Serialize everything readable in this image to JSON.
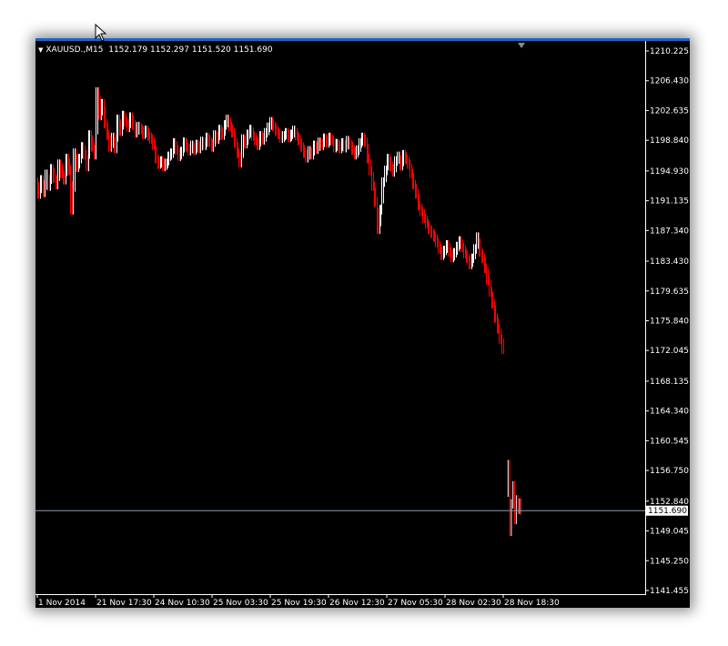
{
  "header": {
    "symbol": "XAUUSD.,M15",
    "ohlc": "1152.179 1152.297 1151.520 1151.690"
  },
  "chart_data": {
    "type": "candlestick",
    "colors": {
      "background": "#000000",
      "up": "#ffffff",
      "down": "#ff0000",
      "bid_line": "#8c9aa8",
      "axis_text": "#ffffff",
      "top_line": "#1f63c8"
    },
    "y_ticks": [
      "1210.225",
      "1206.430",
      "1202.635",
      "1198.840",
      "1194.930",
      "1191.135",
      "1187.340",
      "1183.430",
      "1179.635",
      "1175.840",
      "1172.045",
      "1168.135",
      "1164.340",
      "1160.545",
      "1156.750",
      "1152.840",
      "1149.045",
      "1145.250",
      "1141.455"
    ],
    "x_ticks": [
      "1 Nov 2014",
      "21 Nov 17:30",
      "24 Nov 10:30",
      "25 Nov 03:30",
      "25 Nov 19:30",
      "26 Nov 12:30",
      "27 Nov 05:30",
      "28 Nov 02:30",
      "28 Nov 18:30"
    ],
    "current_price": "1151.690",
    "ylim": [
      1141.455,
      1210.225
    ],
    "path": [
      1193.5,
      1192.0,
      1193.8,
      1192.2,
      1194.5,
      1193.0,
      1195.2,
      1194.0,
      1193.2,
      1195.8,
      1194.6,
      1193.8,
      1196.5,
      1195.0,
      1190.0,
      1197.2,
      1195.4,
      1196.5,
      1198.0,
      1197.0,
      1195.5,
      1199.5,
      1198.0,
      1197.0,
      1205.0,
      1202.0,
      1203.5,
      1201.0,
      1199.5,
      1198.0,
      1199.2,
      1197.8,
      1201.5,
      1200.0,
      1202.0,
      1201.2,
      1200.5,
      1201.8,
      1200.8,
      1199.8,
      1200.6,
      1200.2,
      1199.6,
      1200.1,
      1199.4,
      1199.0,
      1198.2,
      1196.5,
      1195.8,
      1196.2,
      1195.5,
      1195.9,
      1196.8,
      1197.2,
      1198.5,
      1197.6,
      1196.8,
      1197.4,
      1198.6,
      1198.0,
      1197.5,
      1198.2,
      1197.6,
      1198.3,
      1197.8,
      1198.7,
      1198.2,
      1199.2,
      1198.6,
      1198.0,
      1199.5,
      1199.0,
      1200.2,
      1199.5,
      1200.8,
      1201.5,
      1200.6,
      1199.8,
      1198.5,
      1197.2,
      1196.0,
      1199.0,
      1198.4,
      1199.6,
      1200.2,
      1199.4,
      1198.8,
      1198.2,
      1199.4,
      1198.9,
      1199.8,
      1200.5,
      1201.2,
      1200.6,
      1200.0,
      1199.6,
      1199.1,
      1199.4,
      1199.8,
      1199.2,
      1199.6,
      1200.1,
      1199.4,
      1198.8,
      1198.0,
      1197.2,
      1196.6,
      1197.5,
      1197.0,
      1198.2,
      1197.7,
      1198.6,
      1198.2,
      1199.1,
      1198.5,
      1199.2,
      1198.8,
      1197.9,
      1198.4,
      1197.8,
      1198.5,
      1197.9,
      1198.8,
      1198.3,
      1197.6,
      1197.0,
      1197.6,
      1198.5,
      1199.2,
      1198.6,
      1196.5,
      1195.0,
      1193.0,
      1191.0,
      1187.5,
      1190.0,
      1193.5,
      1195.0,
      1196.5,
      1195.5,
      1194.8,
      1196.2,
      1196.8,
      1195.6,
      1197.0,
      1196.4,
      1195.8,
      1194.6,
      1193.2,
      1192.0,
      1190.5,
      1189.8,
      1188.9,
      1188.2,
      1187.5,
      1187.0,
      1186.5,
      1185.8,
      1185.0,
      1184.2,
      1184.8,
      1185.5,
      1184.6,
      1183.9,
      1184.5,
      1185.3,
      1186.0,
      1185.2,
      1184.4,
      1183.8,
      1183.0,
      1183.8,
      1185.0,
      1186.5,
      1184.6,
      1183.8,
      1182.5,
      1181.0,
      1179.5,
      1178.0,
      1176.2,
      1174.8,
      1173.5,
      1172.2
    ],
    "tail_path": [
      1154.0,
      1157.5,
      1149.0,
      1152.5,
      1154.8,
      1150.5,
      1153.0,
      1151.8,
      1152.6,
      1151.7
    ]
  }
}
